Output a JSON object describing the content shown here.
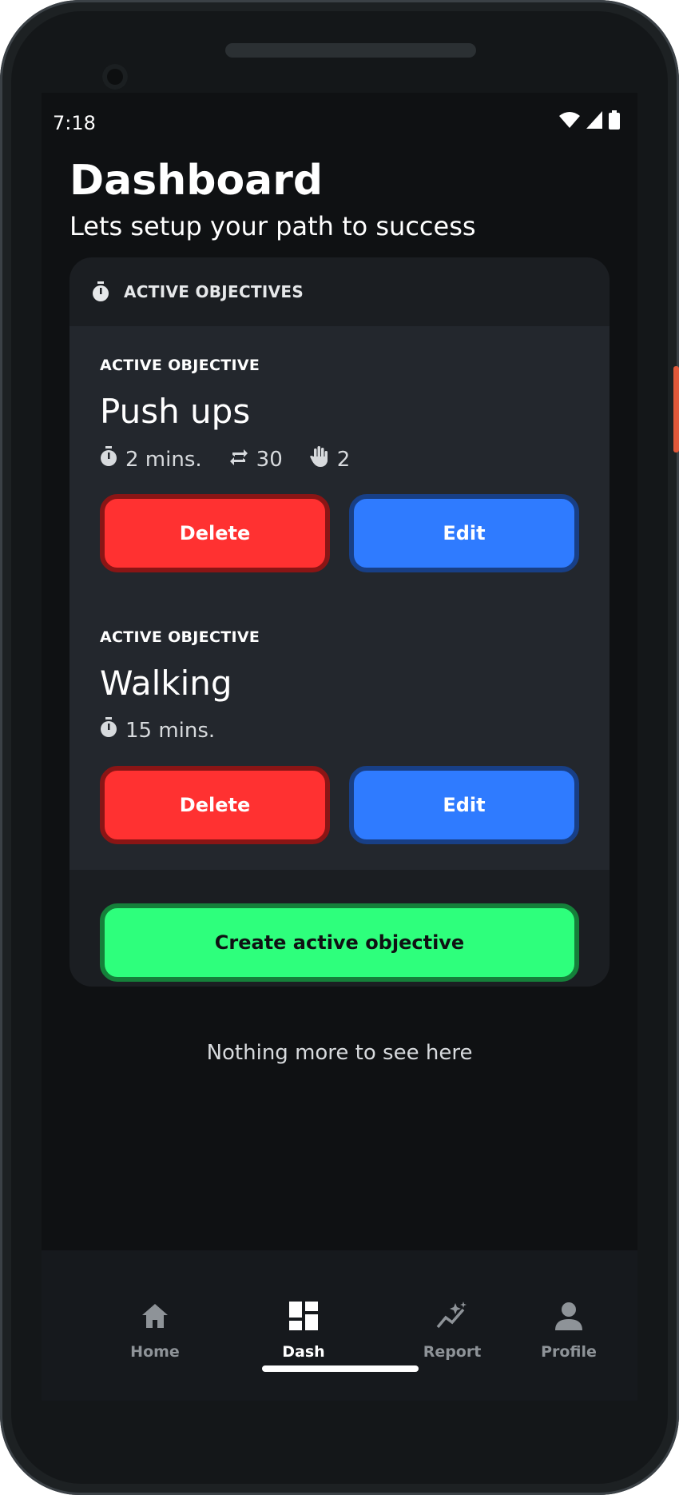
{
  "status_bar": {
    "time": "7:18"
  },
  "header": {
    "title": "Dashboard",
    "subtitle": "Lets setup your path to success"
  },
  "card": {
    "heading": "ACTIVE OBJECTIVES",
    "objectives": [
      {
        "kicker": "ACTIVE OBJECTIVE",
        "name": "Push ups",
        "duration": "2 mins.",
        "reps": "30",
        "sets": "2",
        "delete_label": "Delete",
        "edit_label": "Edit"
      },
      {
        "kicker": "ACTIVE OBJECTIVE",
        "name": "Walking",
        "duration": "15 mins.",
        "delete_label": "Delete",
        "edit_label": "Edit"
      }
    ],
    "create_label": "Create active objective"
  },
  "footer_note": "Nothing more to see here",
  "nav": {
    "items": [
      {
        "label": "Home",
        "icon": "home-icon",
        "active": false
      },
      {
        "label": "Dash",
        "icon": "dashboard-icon",
        "active": true
      },
      {
        "label": "Report",
        "icon": "insights-icon",
        "active": false
      },
      {
        "label": "Profile",
        "icon": "person-icon",
        "active": false
      }
    ]
  },
  "colors": {
    "background": "#0f1113",
    "card": "#1b1e22",
    "delete": "#ff3131",
    "edit": "#2f7bff",
    "create": "#2eff7c"
  }
}
